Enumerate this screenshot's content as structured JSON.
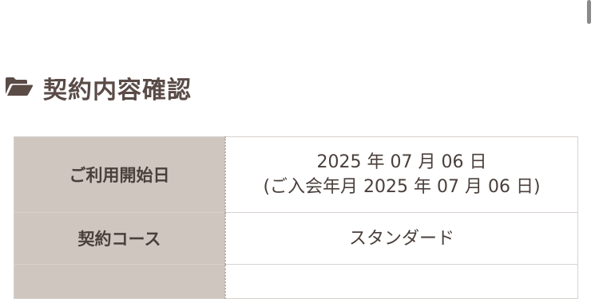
{
  "section": {
    "icon": "folder-open-icon",
    "title": "契約内容確認"
  },
  "contract_table": {
    "rows": [
      {
        "label": "ご利用開始日",
        "value_line1": "2025 年 07 月 06 日",
        "value_line2": "(ご入会年月 2025 年 07 月 06 日)"
      },
      {
        "label": "契約コース",
        "value": "スタンダード"
      },
      {
        "label": "",
        "value": ""
      }
    ]
  },
  "colors": {
    "label_bg": "#cfc6c0",
    "text": "#4a3f3b",
    "border": "#d8d2ce"
  }
}
